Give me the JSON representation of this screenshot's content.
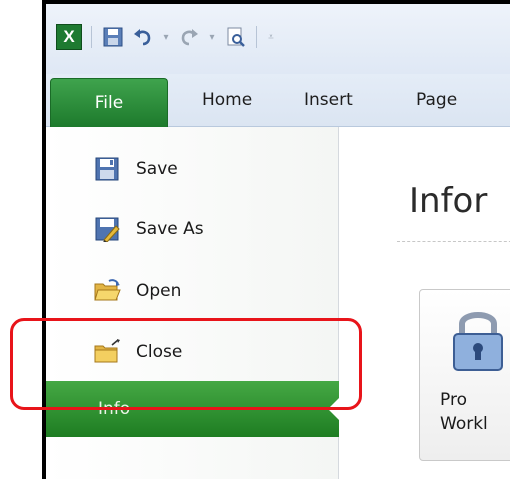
{
  "app": {
    "icon_letter": "X",
    "accent_color": "#1e7a31"
  },
  "quick_access": {
    "buttons": [
      "save-icon",
      "undo-icon",
      "redo-icon",
      "print-preview-icon",
      "customize-icon"
    ]
  },
  "tabs": [
    {
      "label": "File",
      "active": true
    },
    {
      "label": "Home"
    },
    {
      "label": "Insert"
    },
    {
      "label": "Page"
    }
  ],
  "backstage": {
    "menu": [
      {
        "label": "Save",
        "icon": "save-icon"
      },
      {
        "label": "Save As",
        "icon": "save-as-icon"
      },
      {
        "label": "Open",
        "icon": "open-folder-icon"
      },
      {
        "label": "Close",
        "icon": "close-folder-icon"
      },
      {
        "label": "Info",
        "selected": true
      }
    ],
    "content_title": "Infor",
    "protect_button_label": "Pro\nWorkl"
  },
  "annotation": {
    "color": "#e8141a"
  }
}
